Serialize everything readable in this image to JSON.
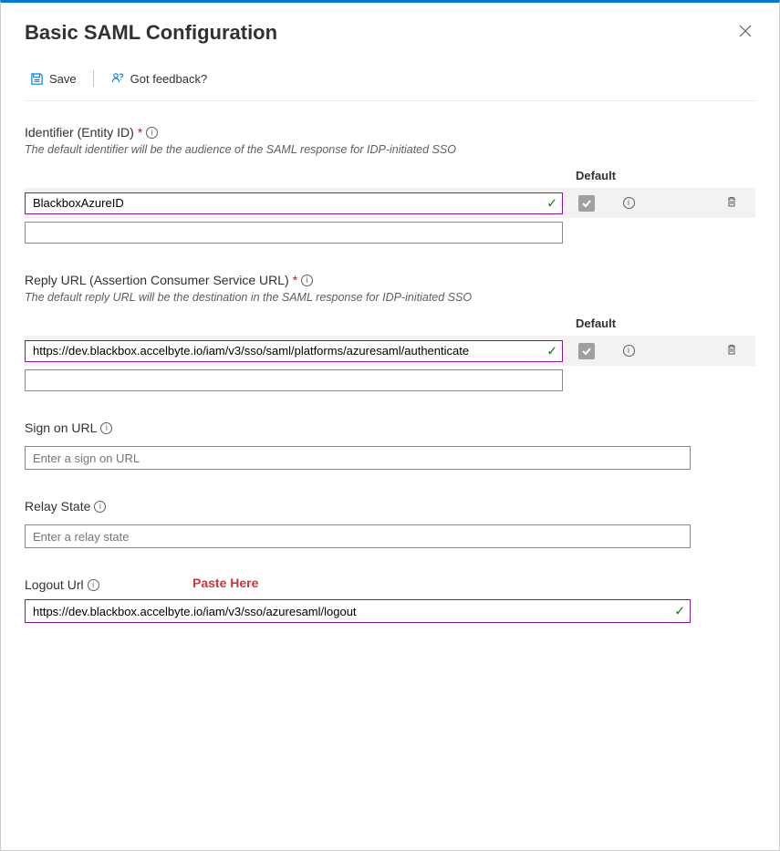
{
  "title": "Basic SAML Configuration",
  "toolbar": {
    "save_label": "Save",
    "feedback_label": "Got feedback?"
  },
  "identifier": {
    "label": "Identifier (Entity ID)",
    "required_mark": "*",
    "desc": "The default identifier will be the audience of the SAML response for IDP-initiated SSO",
    "default_header": "Default",
    "rows": [
      {
        "value": "BlackboxAzureID",
        "validated": true,
        "default_checked": true
      },
      {
        "value": "",
        "validated": false
      }
    ]
  },
  "reply_url": {
    "label": "Reply URL (Assertion Consumer Service URL)",
    "required_mark": "*",
    "desc": "The default reply URL will be the destination in the SAML response for IDP-initiated SSO",
    "default_header": "Default",
    "rows": [
      {
        "value": "https://dev.blackbox.accelbyte.io/iam/v3/sso/saml/platforms/azuresaml/authenticate",
        "validated": true,
        "default_checked": true
      },
      {
        "value": "",
        "validated": false
      }
    ]
  },
  "sign_on_url": {
    "label": "Sign on URL",
    "placeholder": "Enter a sign on URL",
    "value": ""
  },
  "relay_state": {
    "label": "Relay State",
    "placeholder": "Enter a relay state",
    "value": ""
  },
  "logout_url": {
    "label": "Logout Url",
    "annotation": "Paste Here",
    "value": "https://dev.blackbox.accelbyte.io/iam/v3/sso/azuresaml/logout",
    "validated": true
  }
}
